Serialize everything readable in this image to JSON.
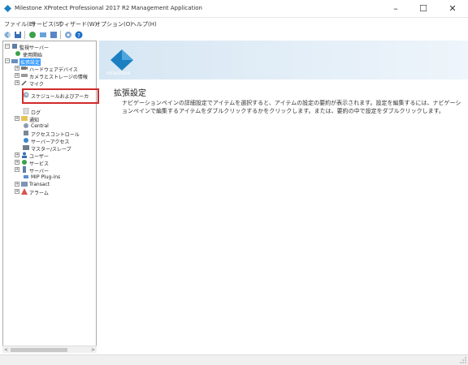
{
  "window": {
    "title": "Milestone XProtect Professional 2017 R2 Management Application",
    "minimize": "–",
    "maximize": "☐",
    "close": "✕"
  },
  "menu": [
    "ファイル(E)",
    "サービス(S)",
    "ウィザード(W)",
    "オプション(O)",
    "ヘルプ(H)"
  ],
  "toolbar_icons": [
    "back-icon",
    "save-icon",
    "start-icon",
    "stop-icon",
    "wizard-icon",
    "settings-icon",
    "help-icon"
  ],
  "tree": {
    "items": [
      {
        "label": "監視サーバー",
        "icon": "server-icon"
      },
      {
        "label": "使用開始",
        "icon": "start-icon"
      },
      {
        "label": "拡張設定",
        "icon": "folder-icon",
        "selected": true
      },
      {
        "label": "ハードウェアデバイス",
        "icon": "camera-icon"
      },
      {
        "label": "カメラとストレージの情報",
        "icon": "storage-icon"
      },
      {
        "label": "マイク",
        "icon": "mic-icon"
      },
      {
        "label": "スケジュールおよびアーカ",
        "icon": "schedule-icon"
      },
      {
        "label": "ログ",
        "icon": "log-icon"
      },
      {
        "label": "通知",
        "icon": "notification-icon"
      },
      {
        "label": "Central",
        "icon": "central-icon"
      },
      {
        "label": "アクセスコントロール",
        "icon": "access-icon"
      },
      {
        "label": "サーバーアクセス",
        "icon": "server-access-icon"
      },
      {
        "label": "マスター/スレーブ",
        "icon": "master-slave-icon"
      },
      {
        "label": "ユーザー",
        "icon": "user-icon"
      },
      {
        "label": "サービス",
        "icon": "service-icon"
      },
      {
        "label": "サーバー",
        "icon": "server-icon"
      },
      {
        "label": "MIP Plug-ins",
        "icon": "plugin-icon"
      },
      {
        "label": "Transact",
        "icon": "transact-icon"
      },
      {
        "label": "アラーム",
        "icon": "alarm-icon"
      }
    ]
  },
  "banner": {
    "logo_text": "milestone"
  },
  "content": {
    "heading": "拡張設定",
    "description": "ナビゲーションペインの詳細設定でアイテムを選択すると、アイテムの設定の要約が表示されます。設定を編集するには、ナビゲーションペインで編集するアイテムをダブルクリックするかをクリックします。または、要約の中で設定をダブルクリックします。"
  },
  "colors": {
    "accent": "#3399ff",
    "highlight": "#d12a2a",
    "logo": "#1a7fc1"
  }
}
